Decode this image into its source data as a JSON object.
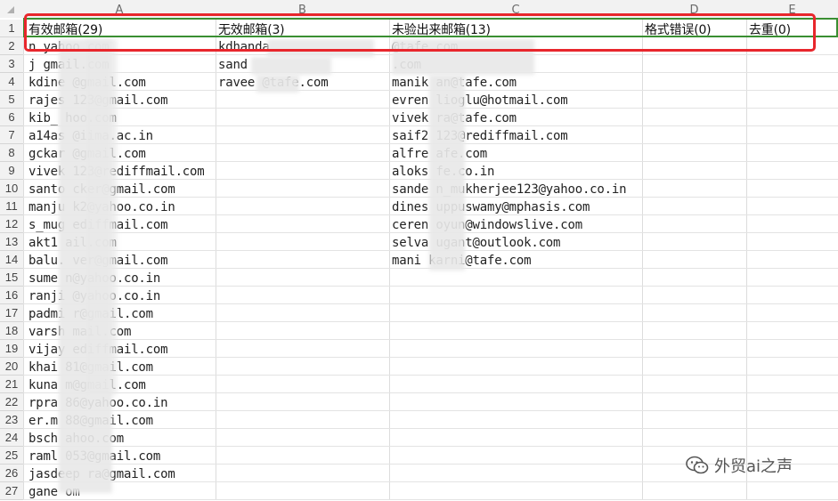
{
  "columns": [
    "A",
    "B",
    "C",
    "D",
    "E"
  ],
  "headers": {
    "a": "有效邮箱(29)",
    "b": "无效邮箱(3)",
    "c": "未验出来邮箱(13)",
    "d": "格式错误(0)",
    "e": "去重(0)"
  },
  "rows": [
    {
      "n": "1"
    },
    {
      "n": "2",
      "a": "n                 yahoo.com",
      "b": "kdhanda",
      "c": "                  @tafe.com"
    },
    {
      "n": "3",
      "a": "j          gmail.com",
      "b": "sand",
      "c": "                .com"
    },
    {
      "n": "4",
      "a": "kdine      @gmail.com",
      "b": "ravee       @tafe.com",
      "c": "manik      an@tafe.com"
    },
    {
      "n": "5",
      "a": "rajes      123@gmail.com",
      "c": "evren      lioglu@hotmail.com"
    },
    {
      "n": "6",
      "a": "kib_     hoo.com",
      "c": "vivek      ra@tafe.com"
    },
    {
      "n": "7",
      "a": "a14as      @iima.ac.in",
      "c": "saif2      123@rediffmail.com"
    },
    {
      "n": "8",
      "a": "gckar      @gmail.com",
      "c": "alfre      afe.com"
    },
    {
      "n": "9",
      "a": "vivek      123@rediffmail.com",
      "c": "aloks      fe.co.in"
    },
    {
      "n": "10",
      "a": "santo      cker@gmail.com",
      "c": "sande      n_mukherjee123@yahoo.co.in"
    },
    {
      "n": "11",
      "a": "manju      k2@yahoo.co.in",
      "c": "dines      uppuswamy@mphasis.com"
    },
    {
      "n": "12",
      "a": "s_mug      ediffmail.com",
      "c": "ceren      oyun@windowslive.com"
    },
    {
      "n": "13",
      "a": "akt1      ail.com",
      "c": "selva      ugant@outlook.com"
    },
    {
      "n": "14",
      "a": "balu.      ver@gmail.com",
      "c": "mani              karni@tafe.com"
    },
    {
      "n": "15",
      "a": "sume      n@yahoo.co.in"
    },
    {
      "n": "16",
      "a": "ranji      @yahoo.co.in"
    },
    {
      "n": "17",
      "a": "padmi      r@gmail.com"
    },
    {
      "n": "18",
      "a": "varsh      mail.com"
    },
    {
      "n": "19",
      "a": "vijay      ediffmail.com"
    },
    {
      "n": "20",
      "a": "khai      81@gmail.com"
    },
    {
      "n": "21",
      "a": "kuna      m@gmail.com"
    },
    {
      "n": "22",
      "a": "rpra      86@yahoo.co.in"
    },
    {
      "n": "23",
      "a": "er.m      88@gmail.com"
    },
    {
      "n": "24",
      "a": "bsch      ahoo.com"
    },
    {
      "n": "25",
      "a": "raml      053@gmail.com"
    },
    {
      "n": "26",
      "a": "jasdeep      ra@gmail.com"
    },
    {
      "n": "27",
      "a": "gane              om"
    }
  ],
  "watermark": {
    "text": "外贸ai之声",
    "icon": "wechat-icon",
    "color": "#555555"
  },
  "colors": {
    "highlight_red": "#e8262c",
    "highlight_green": "#3a8f32"
  }
}
